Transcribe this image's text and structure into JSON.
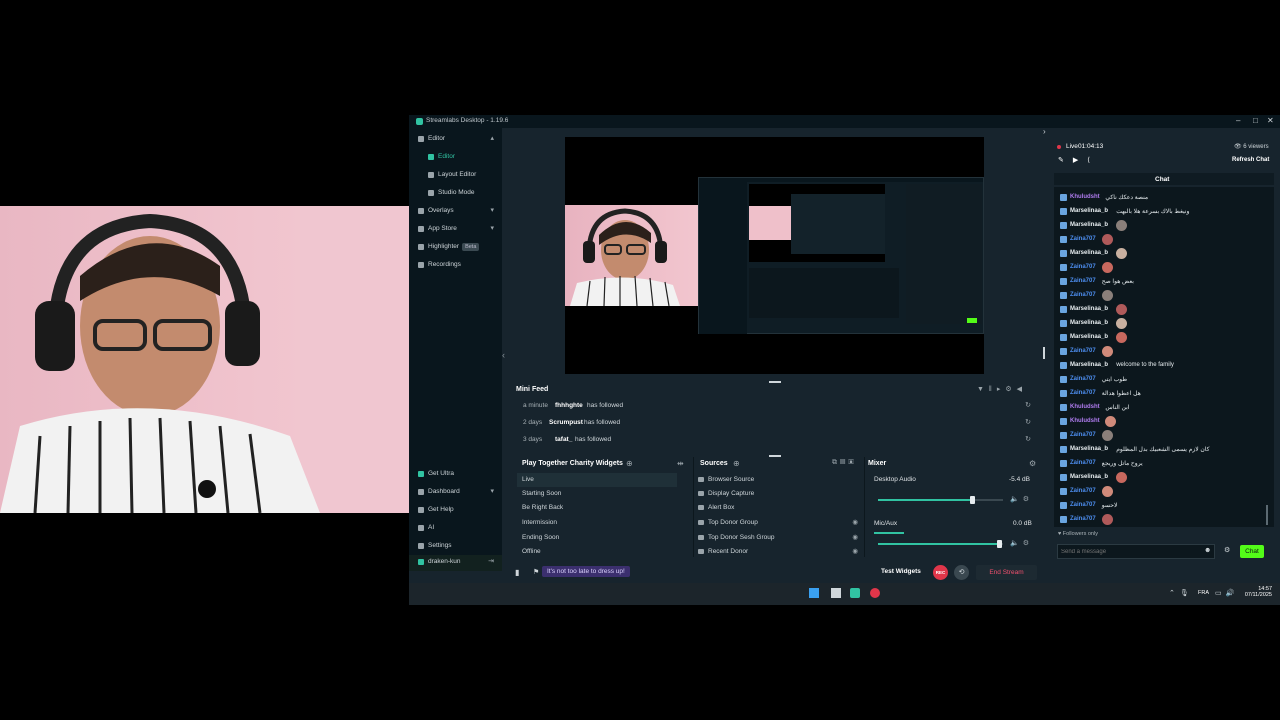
{
  "window": {
    "title": "Streamlabs Desktop - 1.19.6"
  },
  "sidebar": {
    "items": [
      {
        "label": "Editor",
        "chev": "▴"
      },
      {
        "label": "Editor",
        "active": true
      },
      {
        "label": "Layout Editor"
      },
      {
        "label": "Studio Mode"
      },
      {
        "label": "Overlays",
        "chev": "▾"
      },
      {
        "label": "App Store",
        "chev": "▾"
      },
      {
        "label": "Highlighter",
        "badge": "Beta"
      },
      {
        "label": "Recordings"
      }
    ],
    "bottom": [
      {
        "label": "Get Ultra"
      },
      {
        "label": "Dashboard",
        "chev": "▾"
      },
      {
        "label": "Get Help"
      },
      {
        "label": "AI"
      },
      {
        "label": "Settings"
      },
      {
        "label": "draken-kun"
      }
    ]
  },
  "minifeed": {
    "title": "Mini Feed",
    "rows": [
      {
        "ago": "a minute",
        "who": "fhhhghte",
        "what": "has followed"
      },
      {
        "ago": "2 days",
        "who": "Scrumpust",
        "what": "has followed"
      },
      {
        "ago": "3 days",
        "who": "tafat_",
        "what": "has followed"
      }
    ]
  },
  "scenes": {
    "title": "Play Together Charity Widgets",
    "items": [
      "Live",
      "Starting Soon",
      "Be Right Back",
      "Intermission",
      "Ending Soon",
      "Offline"
    ]
  },
  "sources": {
    "title": "Sources",
    "items": [
      "Browser Source",
      "Display Capture",
      "Alert Box",
      "Top Donor Group",
      "Top Donor Sesh Group",
      "Recent Donor"
    ]
  },
  "mixer": {
    "title": "Mixer",
    "tracks": [
      {
        "name": "Desktop Audio",
        "db": "-5.4 dB",
        "level": 0.75
      },
      {
        "name": "Mic/Aux",
        "db": "0.0 dB",
        "level": 0.97
      }
    ]
  },
  "bottombar": {
    "tip": "It's not too late to dress up!",
    "test_widgets": "Test Widgets",
    "rec": "REC",
    "end_stream": "End Stream"
  },
  "chat": {
    "live": "Live",
    "timer": "01:04:13",
    "viewers": "6 viewers",
    "refresh": "Refresh Chat",
    "title": "Chat",
    "followers_only": "Followers only",
    "placeholder": "Send a message",
    "send": "Chat",
    "messages": [
      {
        "user": "Khuludsht",
        "color": "#b07cf0",
        "text": "منصة دعكك ناكي"
      },
      {
        "user": "Marselinaa_b",
        "color": "#e6ecef",
        "text": "ونيغط بالاك بسرعة هلا بالبهت"
      },
      {
        "user": "Marselinaa_b",
        "color": "#e6ecef",
        "text": ""
      },
      {
        "user": "Zaina707",
        "color": "#4d8ef0",
        "text": ""
      },
      {
        "user": "Marselinaa_b",
        "color": "#e6ecef",
        "text": ""
      },
      {
        "user": "Zaina707",
        "color": "#4d8ef0",
        "text": ""
      },
      {
        "user": "Zaina707",
        "color": "#4d8ef0",
        "text": "بعض هوا صح"
      },
      {
        "user": "Zaina707",
        "color": "#4d8ef0",
        "text": ""
      },
      {
        "user": "Marselinaa_b",
        "color": "#e6ecef",
        "text": ""
      },
      {
        "user": "Marselinaa_b",
        "color": "#e6ecef",
        "text": ""
      },
      {
        "user": "Marselinaa_b",
        "color": "#e6ecef",
        "text": ""
      },
      {
        "user": "Zaina707",
        "color": "#4d8ef0",
        "text": ""
      },
      {
        "user": "Marselinaa_b",
        "color": "#e6ecef",
        "text": "welcome to the family"
      },
      {
        "user": "Zaina707",
        "color": "#4d8ef0",
        "text": "طوب ايتي"
      },
      {
        "user": "Zaina707",
        "color": "#4d8ef0",
        "text": "هل اعطوا هدالة"
      },
      {
        "user": "Khuludsht",
        "color": "#b07cf0",
        "text": "ابن الناس"
      },
      {
        "user": "Khuludsht",
        "color": "#b07cf0",
        "text": ""
      },
      {
        "user": "Zaina707",
        "color": "#4d8ef0",
        "text": ""
      },
      {
        "user": "Marselinaa_b",
        "color": "#e6ecef",
        "text": "كان لازم يسمى الشعبيك بدل المظلوم"
      },
      {
        "user": "Zaina707",
        "color": "#4d8ef0",
        "text": "يروح ماتل وريجع"
      },
      {
        "user": "Marselinaa_b",
        "color": "#e6ecef",
        "text": ""
      },
      {
        "user": "Zaina707",
        "color": "#4d8ef0",
        "text": ""
      },
      {
        "user": "Zaina707",
        "color": "#4d8ef0",
        "text": "لاحسو"
      },
      {
        "user": "Zaina707",
        "color": "#4d8ef0",
        "text": ""
      }
    ]
  },
  "taskbar": {
    "time": "14:57",
    "date": "07/11/2025",
    "lang": "FRA"
  }
}
